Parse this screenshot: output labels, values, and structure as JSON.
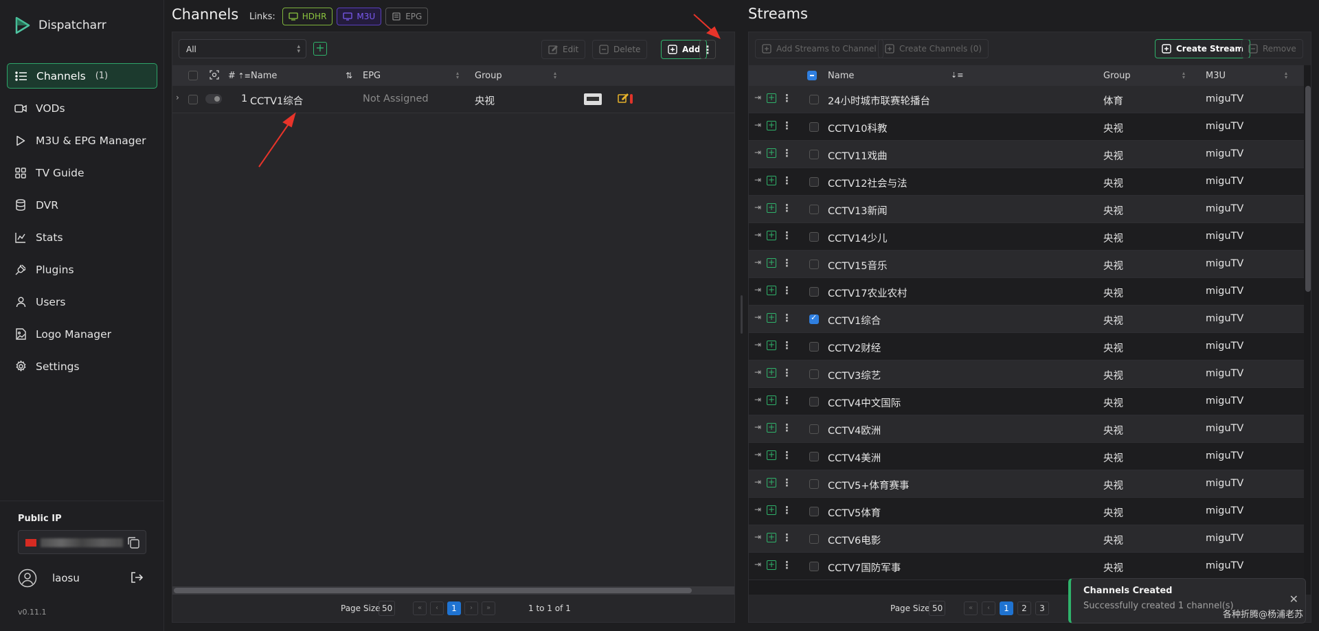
{
  "app": {
    "name": "Dispatcharr",
    "version": "v0.11.1"
  },
  "sidebar": {
    "items": [
      {
        "label": "Channels",
        "count": "(1)",
        "icon": "list-icon",
        "active": true
      },
      {
        "label": "VODs",
        "icon": "video-icon"
      },
      {
        "label": "M3U & EPG Manager",
        "icon": "play-icon"
      },
      {
        "label": "TV Guide",
        "icon": "grid-icon"
      },
      {
        "label": "DVR",
        "icon": "database-icon"
      },
      {
        "label": "Stats",
        "icon": "chart-line-icon"
      },
      {
        "label": "Plugins",
        "icon": "plug-icon"
      },
      {
        "label": "Users",
        "icon": "user-icon"
      },
      {
        "label": "Logo Manager",
        "icon": "file-image-icon"
      },
      {
        "label": "Settings",
        "icon": "gear-icon"
      }
    ],
    "public_ip_label": "Public IP",
    "username": "laosu"
  },
  "channels": {
    "title": "Channels",
    "links_label": "Links:",
    "links": [
      "HDHR",
      "M3U",
      "EPG"
    ],
    "filter_value": "All",
    "toolbar": {
      "edit": "Edit",
      "delete": "Delete",
      "add": "Add"
    },
    "columns": {
      "num": "#",
      "name": "Name",
      "epg": "EPG",
      "group": "Group"
    },
    "rows": [
      {
        "num": "1",
        "name": "CCTV1综合",
        "epg": "Not Assigned",
        "group": "央视"
      }
    ],
    "page_size_label": "Page Size",
    "page_size": "50",
    "current_page": "1",
    "range_text": "1 to 1 of 1"
  },
  "streams": {
    "title": "Streams",
    "toolbar": {
      "add_to_channel": "Add Streams to Channel",
      "create_channels": "Create Channels (0)",
      "create_stream": "Create Stream",
      "remove": "Remove"
    },
    "columns": {
      "name": "Name",
      "group": "Group",
      "m3u": "M3U"
    },
    "rows": [
      {
        "name": "24小时城市联赛轮播台",
        "group": "体育",
        "m3u": "miguTV",
        "checked": false
      },
      {
        "name": "CCTV10科教",
        "group": "央视",
        "m3u": "miguTV",
        "checked": false
      },
      {
        "name": "CCTV11戏曲",
        "group": "央视",
        "m3u": "miguTV",
        "checked": false
      },
      {
        "name": "CCTV12社会与法",
        "group": "央视",
        "m3u": "miguTV",
        "checked": false
      },
      {
        "name": "CCTV13新闻",
        "group": "央视",
        "m3u": "miguTV",
        "checked": false
      },
      {
        "name": "CCTV14少儿",
        "group": "央视",
        "m3u": "miguTV",
        "checked": false
      },
      {
        "name": "CCTV15音乐",
        "group": "央视",
        "m3u": "miguTV",
        "checked": false
      },
      {
        "name": "CCTV17农业农村",
        "group": "央视",
        "m3u": "miguTV",
        "checked": false
      },
      {
        "name": "CCTV1综合",
        "group": "央视",
        "m3u": "miguTV",
        "checked": true
      },
      {
        "name": "CCTV2财经",
        "group": "央视",
        "m3u": "miguTV",
        "checked": false
      },
      {
        "name": "CCTV3综艺",
        "group": "央视",
        "m3u": "miguTV",
        "checked": false
      },
      {
        "name": "CCTV4中文国际",
        "group": "央视",
        "m3u": "miguTV",
        "checked": false
      },
      {
        "name": "CCTV4欧洲",
        "group": "央视",
        "m3u": "miguTV",
        "checked": false
      },
      {
        "name": "CCTV4美洲",
        "group": "央视",
        "m3u": "miguTV",
        "checked": false
      },
      {
        "name": "CCTV5+体育赛事",
        "group": "央视",
        "m3u": "miguTV",
        "checked": false
      },
      {
        "name": "CCTV5体育",
        "group": "央视",
        "m3u": "miguTV",
        "checked": false
      },
      {
        "name": "CCTV6电影",
        "group": "央视",
        "m3u": "miguTV",
        "checked": false
      },
      {
        "name": "CCTV7国防军事",
        "group": "央视",
        "m3u": "miguTV",
        "checked": false
      }
    ],
    "page_size_label": "Page Size",
    "page_size": "50",
    "pages": [
      "1",
      "2",
      "3"
    ]
  },
  "toast": {
    "title": "Channels Created",
    "message": "Successfully created 1 channel(s)"
  },
  "watermark": "各种折腾@杨浦老苏",
  "colors": {
    "accent": "#2fb36b",
    "primary": "#1f73d1",
    "annotation": "#e8342a"
  }
}
